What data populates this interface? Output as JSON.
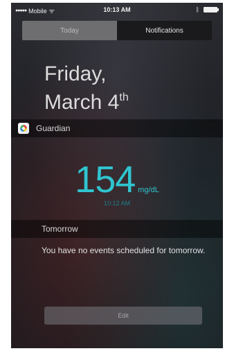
{
  "status_bar": {
    "signal_dots": "●●●●●",
    "carrier": "Mobile",
    "wifi_glyph": "ᯤ",
    "time": "10:13 AM",
    "bluetooth_glyph": "ᛒ"
  },
  "tabs": [
    {
      "label": "Today",
      "selected": true
    },
    {
      "label": "Notifications",
      "selected": false
    }
  ],
  "date": {
    "weekday": "Friday,",
    "month_day": "March 4",
    "ordinal_suffix": "th"
  },
  "widget": {
    "app_name": "Guardian",
    "app_icon": "guardian-app-icon",
    "glucose_value": "154",
    "glucose_unit": "mg/dL",
    "reading_time": "10:12 AM",
    "accent_color": "#2fc4cf"
  },
  "tomorrow": {
    "title": "Tomorrow",
    "message": "You have no events scheduled for tomorrow."
  },
  "edit_button": {
    "label": "Edit"
  }
}
